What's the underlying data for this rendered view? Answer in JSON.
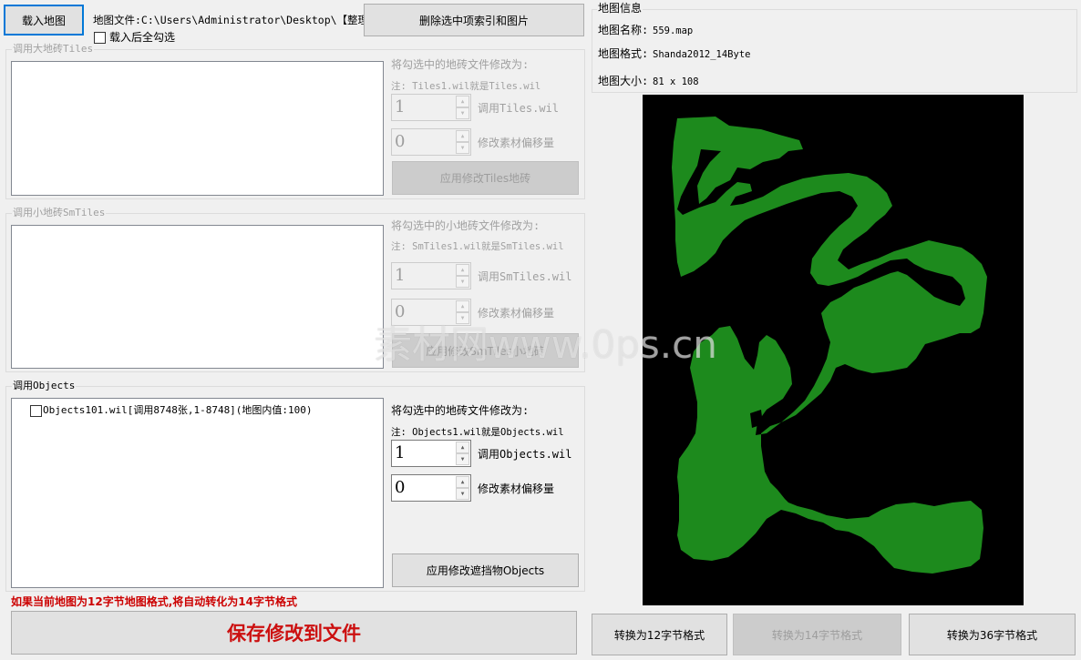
{
  "top": {
    "load_button": "载入地图",
    "file_label": "地图文件:C:\\Users\\Administrator\\Desktop\\【整理8】:",
    "delete_button": "删除选中项索引和图片",
    "select_all_checkbox": "载入后全勾选"
  },
  "tiles": {
    "group_title": "调用大地砖Tiles",
    "modify_heading": "将勾选中的地砖文件修改为:",
    "note": "注: Tiles1.wil就是Tiles.wil",
    "file_value": "1",
    "file_label": "调用Tiles.wil",
    "offset_value": "0",
    "offset_label": "修改素材偏移量",
    "apply_button": "应用修改Tiles地砖"
  },
  "smtiles": {
    "group_title": "调用小地砖SmTiles",
    "modify_heading": "将勾选中的小地砖文件修改为:",
    "note": "注: SmTiles1.wil就是SmTiles.wil",
    "file_value": "1",
    "file_label": "调用SmTiles.wil",
    "offset_value": "0",
    "offset_label": "修改素材偏移量",
    "apply_button": "应用修改SmTiles小地砖"
  },
  "objects": {
    "group_title": "调用Objects",
    "list_items": [
      "Objects101.wil[调用8748张,1-8748](地图内值:100)"
    ],
    "modify_heading": "将勾选中的地砖文件修改为:",
    "note": "注: Objects1.wil就是Objects.wil",
    "file_value": "1",
    "file_label": "调用Objects.wil",
    "offset_value": "0",
    "offset_label": "修改素材偏移量",
    "apply_button": "应用修改遮挡物Objects"
  },
  "warning": "如果当前地图为12字节地图格式,将自动转化为14字节格式",
  "save_button": "保存修改到文件",
  "map_info": {
    "title": "地图信息",
    "name_label": "地图名称:",
    "name_value": "559.map",
    "format_label": "地图格式:",
    "format_value": "Shanda2012_14Byte",
    "size_label": "地图大小:",
    "size_value": "81 x 108"
  },
  "convert_buttons": [
    "转换为12字节格式",
    "转换为14字节格式",
    "转换为36字节格式"
  ],
  "watermark": "素材网www.0ps.cn",
  "colors": {
    "map_background": "#000000",
    "map_terrain": "#1d8a1d",
    "warning_text": "#cc0000",
    "save_text": "#cc1010",
    "focus_border": "#0078d7"
  }
}
